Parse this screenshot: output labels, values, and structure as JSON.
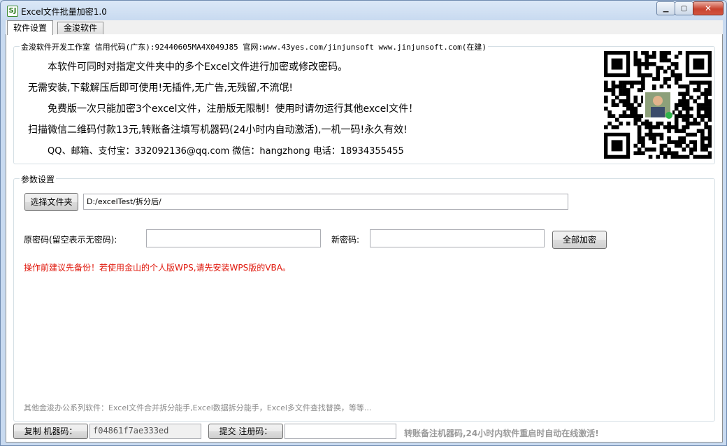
{
  "window": {
    "title": "Excel文件批量加密1.0",
    "app_icon": "SJ"
  },
  "tabs": [
    {
      "label": "软件设置",
      "active": true
    },
    {
      "label": "金浚软件",
      "active": false
    }
  ],
  "info": {
    "legend": "金浚软件开发工作室 信用代码(广东):92440605MA4X049J85 官网:www.43yes.com/jinjunsoft  www.jinjunsoft.com(在建)",
    "lines": [
      "本软件可同时对指定文件夹中的多个Excel文件进行加密或修改密码。",
      "无需安装,下载解压后即可使用!无插件,无广告,无残留,不流氓!",
      "免费版一次只能加密3个excel文件，注册版无限制！使用时请勿运行其他excel文件！",
      "扫描微信二维码付款13元,转账备注填写机器码(24小时内自动激活),一机一码!永久有效!",
      "QQ、邮箱、支付宝：332092136@qq.com    微信：hangzhong    电话：18934355455"
    ]
  },
  "params": {
    "legend": "参数设置",
    "choose_folder_label": "选择文件夹",
    "folder_path": "D:/excelTest/拆分后/",
    "old_pwd_label": "原密码(留空表示无密码):",
    "old_pwd_value": "",
    "new_pwd_label": "新密码:",
    "new_pwd_value": "",
    "encrypt_all_label": "全部加密",
    "warning": "操作前建议先备份！若使用金山的个人版WPS,请先安装WPS版的VBA。",
    "footer_note": "其他金浚办公系列软件：Excel文件合并拆分能手,Excel数据拆分能手，Excel多文件查找替换，等等..."
  },
  "status": {
    "copy_machine_label": "复制 机器码：",
    "machine_code": "f04861f7ae333ed",
    "submit_reg_label": "提交 注册码：",
    "reg_code": "",
    "message": "转账备注机器码,24小时内软件重启时自动在线激活!"
  },
  "colors": {
    "warning": "#e0170b",
    "window_frame": "#c8daf0",
    "close_button": "#c8432f"
  }
}
